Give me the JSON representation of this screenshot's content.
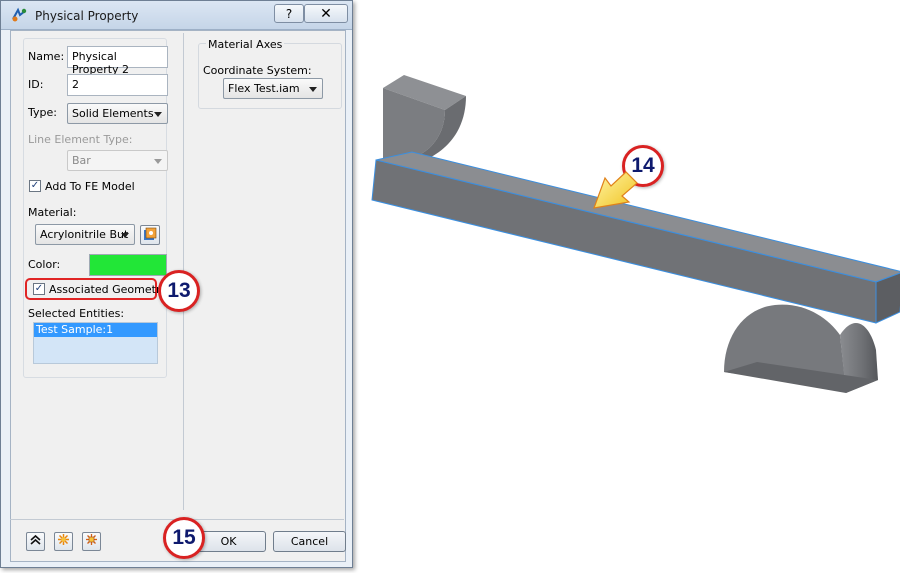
{
  "window": {
    "title": "Physical Property",
    "help_label": "?",
    "close_label": "✕"
  },
  "form": {
    "name_label": "Name:",
    "name_value": "Physical Property 2",
    "id_label": "ID:",
    "id_value": "2",
    "type_label": "Type:",
    "type_value": "Solid Elements",
    "line_element_type_label": "Line Element Type:",
    "line_element_type_value": "Bar",
    "add_to_fe_label": "Add To FE Model",
    "add_to_fe_checked": true,
    "material_label": "Material:",
    "material_value": "Acrylonitrile But",
    "color_label": "Color:",
    "color_value": "#22e637",
    "associated_geometry_label": "Associated Geometry",
    "associated_geometry_checked": true,
    "selected_entities_label": "Selected Entities:",
    "selected_entities": [
      "Test Sample:1"
    ]
  },
  "material_axes": {
    "group_label": "Material Axes",
    "coord_label": "Coordinate System:",
    "coord_value": "Flex Test.iam"
  },
  "footer": {
    "ok_label": "OK",
    "cancel_label": "Cancel"
  },
  "callouts": {
    "c13": "13",
    "c14": "14",
    "c15": "15"
  },
  "icons": {
    "title": "physical-property-icon",
    "collapse": "double-chevron-up-icon",
    "expand_a": "sunburst-icon",
    "expand_b": "sunburst-grid-icon",
    "material_browse": "material-browser-icon"
  },
  "colors": {
    "callout_ring": "#d92222",
    "callout_text": "#0e1a6e",
    "selection": "#3399ff",
    "model_edge": "#3b8fe0",
    "model_face": "#7a7c80"
  }
}
